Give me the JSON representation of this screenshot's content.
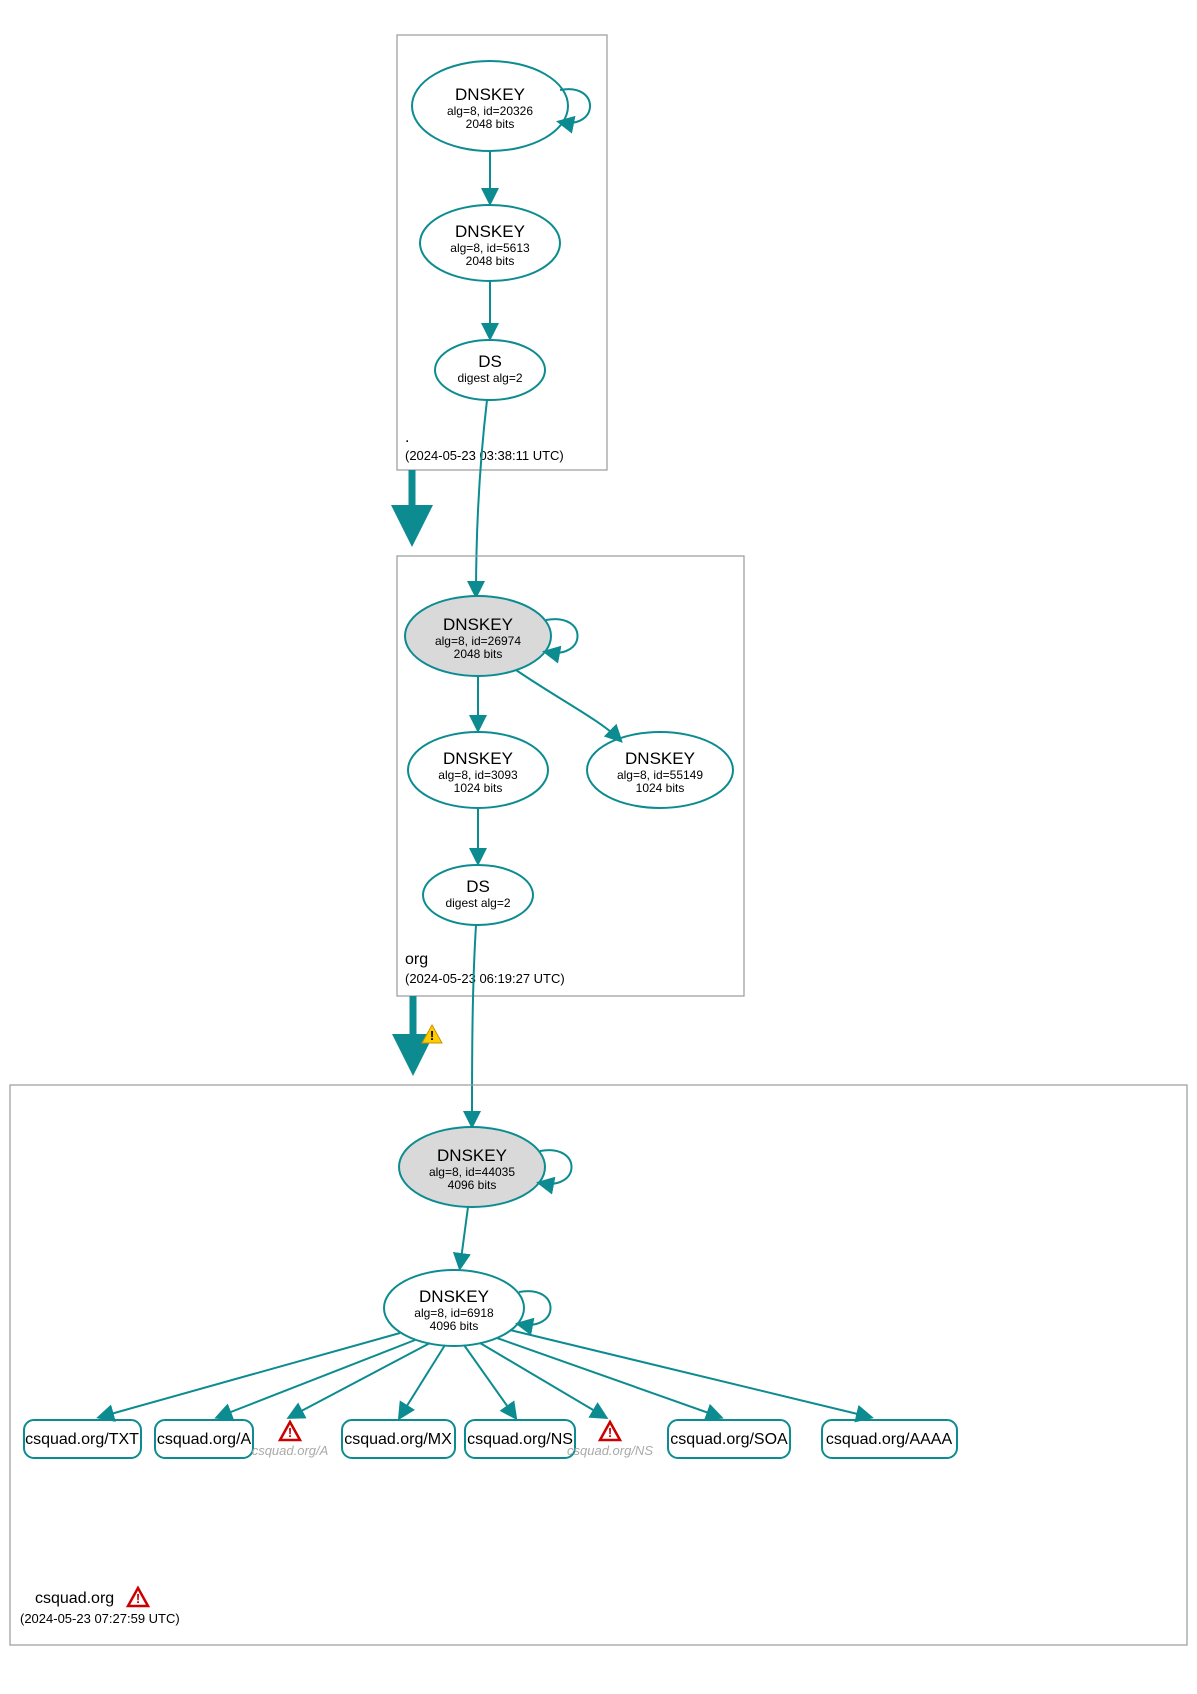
{
  "zones": {
    "root": {
      "name": ".",
      "time": "(2024-05-23 03:38:11 UTC)",
      "dnskey1": {
        "title": "DNSKEY",
        "sub1": "alg=8, id=20326",
        "sub2": "2048 bits"
      },
      "dnskey2": {
        "title": "DNSKEY",
        "sub1": "alg=8, id=5613",
        "sub2": "2048 bits"
      },
      "ds": {
        "title": "DS",
        "sub1": "digest alg=2"
      }
    },
    "org": {
      "name": "org",
      "time": "(2024-05-23 06:19:27 UTC)",
      "dnskey1": {
        "title": "DNSKEY",
        "sub1": "alg=8, id=26974",
        "sub2": "2048 bits"
      },
      "dnskey2": {
        "title": "DNSKEY",
        "sub1": "alg=8, id=3093",
        "sub2": "1024 bits"
      },
      "dnskey3": {
        "title": "DNSKEY",
        "sub1": "alg=8, id=55149",
        "sub2": "1024 bits"
      },
      "ds": {
        "title": "DS",
        "sub1": "digest alg=2"
      }
    },
    "csquad": {
      "name": "csquad.org",
      "time": "(2024-05-23 07:27:59 UTC)",
      "dnskey1": {
        "title": "DNSKEY",
        "sub1": "alg=8, id=44035",
        "sub2": "4096 bits"
      },
      "dnskey2": {
        "title": "DNSKEY",
        "sub1": "alg=8, id=6918",
        "sub2": "4096 bits"
      },
      "rr": {
        "txt": "csquad.org/TXT",
        "a": "csquad.org/A",
        "a_ghost": "csquad.org/A",
        "mx": "csquad.org/MX",
        "ns": "csquad.org/NS",
        "ns_ghost": "csquad.org/NS",
        "soa": "csquad.org/SOA",
        "aaaa": "csquad.org/AAAA"
      }
    }
  }
}
